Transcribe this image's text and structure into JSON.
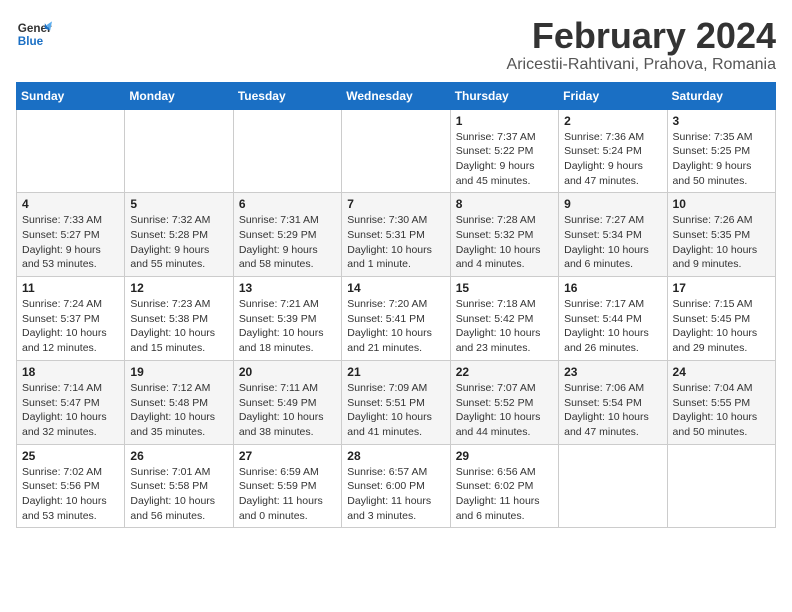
{
  "header": {
    "logo_general": "General",
    "logo_blue": "Blue",
    "month": "February 2024",
    "location": "Aricestii-Rahtivani, Prahova, Romania"
  },
  "weekdays": [
    "Sunday",
    "Monday",
    "Tuesday",
    "Wednesday",
    "Thursday",
    "Friday",
    "Saturday"
  ],
  "weeks": [
    [
      {
        "day": "",
        "info": ""
      },
      {
        "day": "",
        "info": ""
      },
      {
        "day": "",
        "info": ""
      },
      {
        "day": "",
        "info": ""
      },
      {
        "day": "1",
        "info": "Sunrise: 7:37 AM\nSunset: 5:22 PM\nDaylight: 9 hours and 45 minutes."
      },
      {
        "day": "2",
        "info": "Sunrise: 7:36 AM\nSunset: 5:24 PM\nDaylight: 9 hours and 47 minutes."
      },
      {
        "day": "3",
        "info": "Sunrise: 7:35 AM\nSunset: 5:25 PM\nDaylight: 9 hours and 50 minutes."
      }
    ],
    [
      {
        "day": "4",
        "info": "Sunrise: 7:33 AM\nSunset: 5:27 PM\nDaylight: 9 hours and 53 minutes."
      },
      {
        "day": "5",
        "info": "Sunrise: 7:32 AM\nSunset: 5:28 PM\nDaylight: 9 hours and 55 minutes."
      },
      {
        "day": "6",
        "info": "Sunrise: 7:31 AM\nSunset: 5:29 PM\nDaylight: 9 hours and 58 minutes."
      },
      {
        "day": "7",
        "info": "Sunrise: 7:30 AM\nSunset: 5:31 PM\nDaylight: 10 hours and 1 minute."
      },
      {
        "day": "8",
        "info": "Sunrise: 7:28 AM\nSunset: 5:32 PM\nDaylight: 10 hours and 4 minutes."
      },
      {
        "day": "9",
        "info": "Sunrise: 7:27 AM\nSunset: 5:34 PM\nDaylight: 10 hours and 6 minutes."
      },
      {
        "day": "10",
        "info": "Sunrise: 7:26 AM\nSunset: 5:35 PM\nDaylight: 10 hours and 9 minutes."
      }
    ],
    [
      {
        "day": "11",
        "info": "Sunrise: 7:24 AM\nSunset: 5:37 PM\nDaylight: 10 hours and 12 minutes."
      },
      {
        "day": "12",
        "info": "Sunrise: 7:23 AM\nSunset: 5:38 PM\nDaylight: 10 hours and 15 minutes."
      },
      {
        "day": "13",
        "info": "Sunrise: 7:21 AM\nSunset: 5:39 PM\nDaylight: 10 hours and 18 minutes."
      },
      {
        "day": "14",
        "info": "Sunrise: 7:20 AM\nSunset: 5:41 PM\nDaylight: 10 hours and 21 minutes."
      },
      {
        "day": "15",
        "info": "Sunrise: 7:18 AM\nSunset: 5:42 PM\nDaylight: 10 hours and 23 minutes."
      },
      {
        "day": "16",
        "info": "Sunrise: 7:17 AM\nSunset: 5:44 PM\nDaylight: 10 hours and 26 minutes."
      },
      {
        "day": "17",
        "info": "Sunrise: 7:15 AM\nSunset: 5:45 PM\nDaylight: 10 hours and 29 minutes."
      }
    ],
    [
      {
        "day": "18",
        "info": "Sunrise: 7:14 AM\nSunset: 5:47 PM\nDaylight: 10 hours and 32 minutes."
      },
      {
        "day": "19",
        "info": "Sunrise: 7:12 AM\nSunset: 5:48 PM\nDaylight: 10 hours and 35 minutes."
      },
      {
        "day": "20",
        "info": "Sunrise: 7:11 AM\nSunset: 5:49 PM\nDaylight: 10 hours and 38 minutes."
      },
      {
        "day": "21",
        "info": "Sunrise: 7:09 AM\nSunset: 5:51 PM\nDaylight: 10 hours and 41 minutes."
      },
      {
        "day": "22",
        "info": "Sunrise: 7:07 AM\nSunset: 5:52 PM\nDaylight: 10 hours and 44 minutes."
      },
      {
        "day": "23",
        "info": "Sunrise: 7:06 AM\nSunset: 5:54 PM\nDaylight: 10 hours and 47 minutes."
      },
      {
        "day": "24",
        "info": "Sunrise: 7:04 AM\nSunset: 5:55 PM\nDaylight: 10 hours and 50 minutes."
      }
    ],
    [
      {
        "day": "25",
        "info": "Sunrise: 7:02 AM\nSunset: 5:56 PM\nDaylight: 10 hours and 53 minutes."
      },
      {
        "day": "26",
        "info": "Sunrise: 7:01 AM\nSunset: 5:58 PM\nDaylight: 10 hours and 56 minutes."
      },
      {
        "day": "27",
        "info": "Sunrise: 6:59 AM\nSunset: 5:59 PM\nDaylight: 11 hours and 0 minutes."
      },
      {
        "day": "28",
        "info": "Sunrise: 6:57 AM\nSunset: 6:00 PM\nDaylight: 11 hours and 3 minutes."
      },
      {
        "day": "29",
        "info": "Sunrise: 6:56 AM\nSunset: 6:02 PM\nDaylight: 11 hours and 6 minutes."
      },
      {
        "day": "",
        "info": ""
      },
      {
        "day": "",
        "info": ""
      }
    ]
  ]
}
